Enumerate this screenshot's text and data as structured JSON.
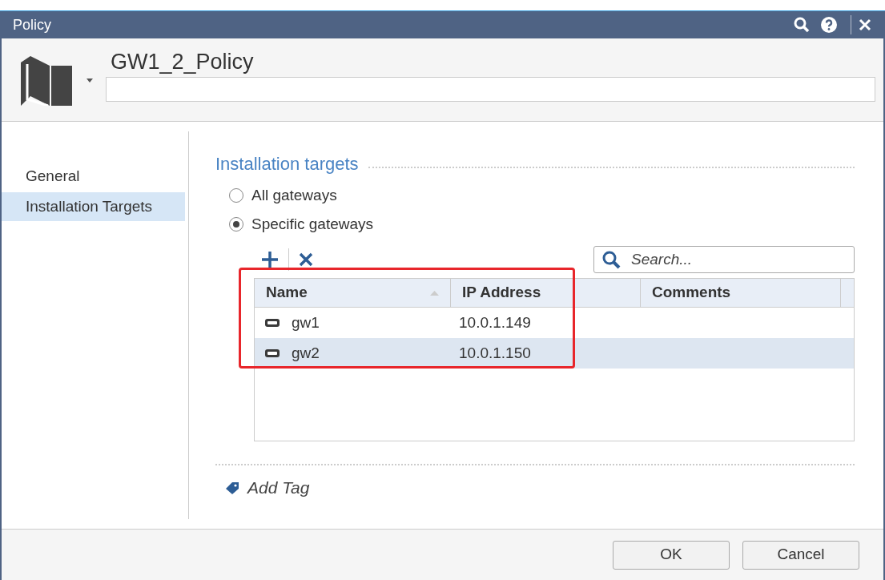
{
  "window": {
    "title": "Policy"
  },
  "header": {
    "name": "GW1_2_Policy"
  },
  "sidebar": {
    "items": [
      {
        "label": "General",
        "selected": false
      },
      {
        "label": "Installation Targets",
        "selected": true
      }
    ]
  },
  "section": {
    "title": "Installation targets"
  },
  "options": [
    {
      "label": "All gateways",
      "selected": false
    },
    {
      "label": "Specific gateways",
      "selected": true
    }
  ],
  "search": {
    "placeholder": "Search..."
  },
  "table": {
    "columns": [
      "Name",
      "IP Address",
      "Comments"
    ],
    "rows": [
      {
        "name": "gw1",
        "ip": "10.0.1.149",
        "selected": false
      },
      {
        "name": "gw2",
        "ip": "10.0.1.150",
        "selected": true
      }
    ]
  },
  "add_tag": "Add Tag",
  "buttons": [
    "OK",
    "Cancel"
  ]
}
